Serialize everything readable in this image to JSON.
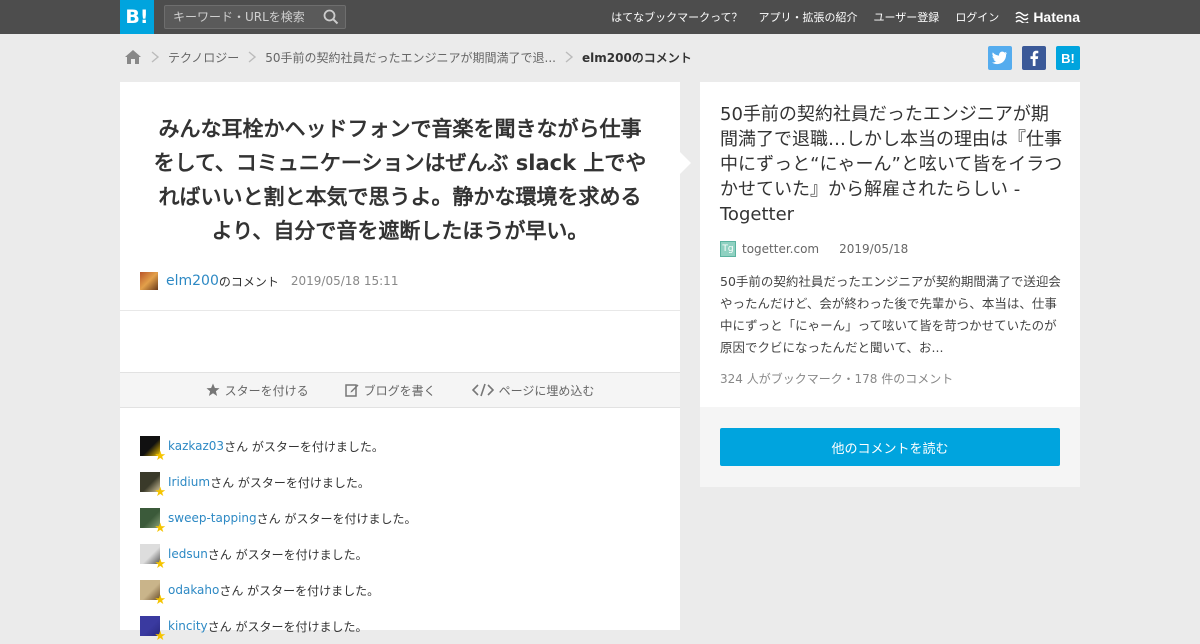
{
  "header": {
    "logo": "B!",
    "search_placeholder": "キーワード・URLを検索",
    "nav": [
      "はてなブックマークって？",
      "アプリ・拡張の紹介",
      "ユーザー登録",
      "ログイン"
    ],
    "brand": "Hatena"
  },
  "breadcrumb": {
    "category": "テクノロジー",
    "entry": "50手前の契約社員だったエンジニアが期間満了で退...",
    "current": "elm200のコメント"
  },
  "share": {
    "twitter": "t",
    "facebook": "f",
    "hatena": "B!"
  },
  "comment": {
    "text": "みんな耳栓かヘッドフォンで音楽を聞きながら仕事をして、コミュニケーションはぜんぶ slack 上でやればいいと割と本気で思うよ。静かな環境を求めるより、自分で音を遮断したほうが早い。",
    "user": "elm200",
    "suffix": "のコメント",
    "date": "2019/05/18 15:11"
  },
  "actions": {
    "star": "スターを付ける",
    "blog": "ブログを書く",
    "embed": "ページに埋め込む"
  },
  "stars": [
    {
      "user": "kazkaz03",
      "text": "さん がスターを付けました。",
      "color": "#111111",
      "accent": "#f2c400"
    },
    {
      "user": "Iridium",
      "text": "さん がスターを付けました。",
      "color": "#3a3a2a",
      "accent": "#d9c9a0"
    },
    {
      "user": "sweep-tapping",
      "text": "さん がスターを付けました。",
      "color": "#3b5a3a",
      "accent": "#8aa07a"
    },
    {
      "user": "ledsun",
      "text": "さん がスターを付けました。",
      "color": "#dddddd",
      "accent": "#555555"
    },
    {
      "user": "odakaho",
      "text": "さん がスターを付けました。",
      "color": "#c9b48a",
      "accent": "#6a4e2a"
    },
    {
      "user": "kincity",
      "text": "さん がスターを付けました。",
      "color": "#3a3aa0",
      "accent": "#2a2a80"
    }
  ],
  "entry": {
    "title": "50手前の契約社員だったエンジニアが期間満了で退職…しかし本当の理由は『仕事中にずっと“にゃーん”と呟いて皆をイラつかせていた』から解雇されたらしい - Togetter",
    "source": "togetter.com",
    "date": "2019/05/18",
    "summary": "50手前の契約社員だったエンジニアが契約期間満了で送迎会やったんだけど、会が終わった後で先輩から、本当は、仕事中にずっと「にゃーん」って呟いて皆を苛つかせていたのが原因でクビになったんだと聞いて、お...",
    "counts": "324 人がブックマーク・178 件のコメント"
  },
  "more_button": "他のコメントを読む",
  "colors": {
    "accent": "#00a4de",
    "link": "#2d89c4",
    "topbar": "#4d4d4d"
  }
}
